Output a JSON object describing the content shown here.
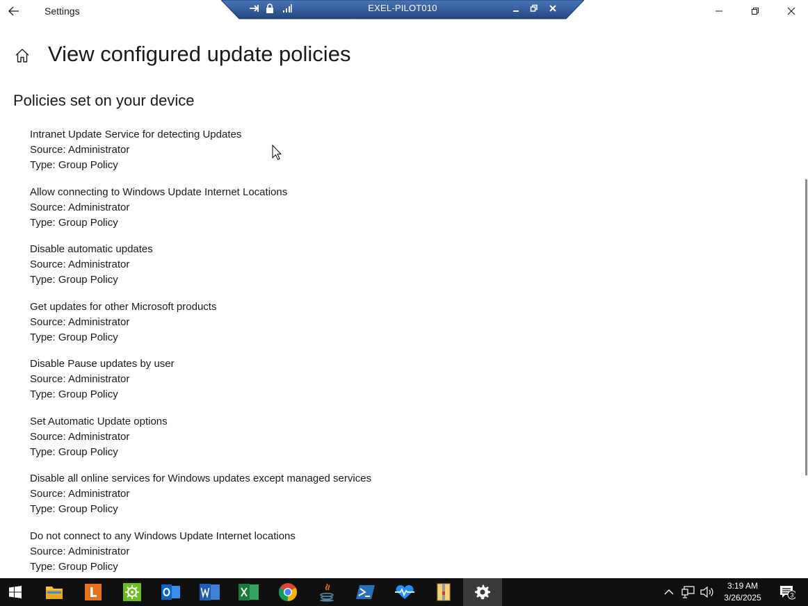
{
  "window": {
    "app_title": "Settings",
    "remote_session_name": "EXEL-PILOT010"
  },
  "page": {
    "title": "View configured update policies",
    "section_title": "Policies set on your device"
  },
  "policies": [
    {
      "name": "Intranet Update Service for detecting Updates",
      "source": "Source: Administrator",
      "type": "Type: Group Policy"
    },
    {
      "name": "Allow connecting to Windows Update Internet Locations",
      "source": "Source: Administrator",
      "type": "Type: Group Policy"
    },
    {
      "name": "Disable automatic updates",
      "source": "Source: Administrator",
      "type": "Type: Group Policy"
    },
    {
      "name": "Get updates for other Microsoft products",
      "source": "Source: Administrator",
      "type": "Type: Group Policy"
    },
    {
      "name": "Disable Pause updates by user",
      "source": "Source: Administrator",
      "type": "Type: Group Policy"
    },
    {
      "name": "Set Automatic Update options",
      "source": "Source: Administrator",
      "type": "Type: Group Policy"
    },
    {
      "name": "Disable all online services for Windows updates except managed services",
      "source": "Source: Administrator",
      "type": "Type: Group Policy"
    },
    {
      "name": "Do not connect to any Windows Update Internet locations",
      "source": "Source: Administrator",
      "type": "Type: Group Policy"
    }
  ],
  "taskbar": {
    "apps": [
      "windows-start",
      "file-explorer",
      "l-app",
      "green-app",
      "outlook",
      "word",
      "excel",
      "chrome",
      "java",
      "powershell",
      "health-monitor",
      "archive",
      "settings"
    ],
    "active_app": "settings",
    "time": "3:19 AM",
    "date": "3/26/2025",
    "notification_count": "3"
  },
  "colors": {
    "rdp_bar": "#2f5a9c",
    "taskbar": "#101010",
    "text": "#1a1a1a"
  }
}
